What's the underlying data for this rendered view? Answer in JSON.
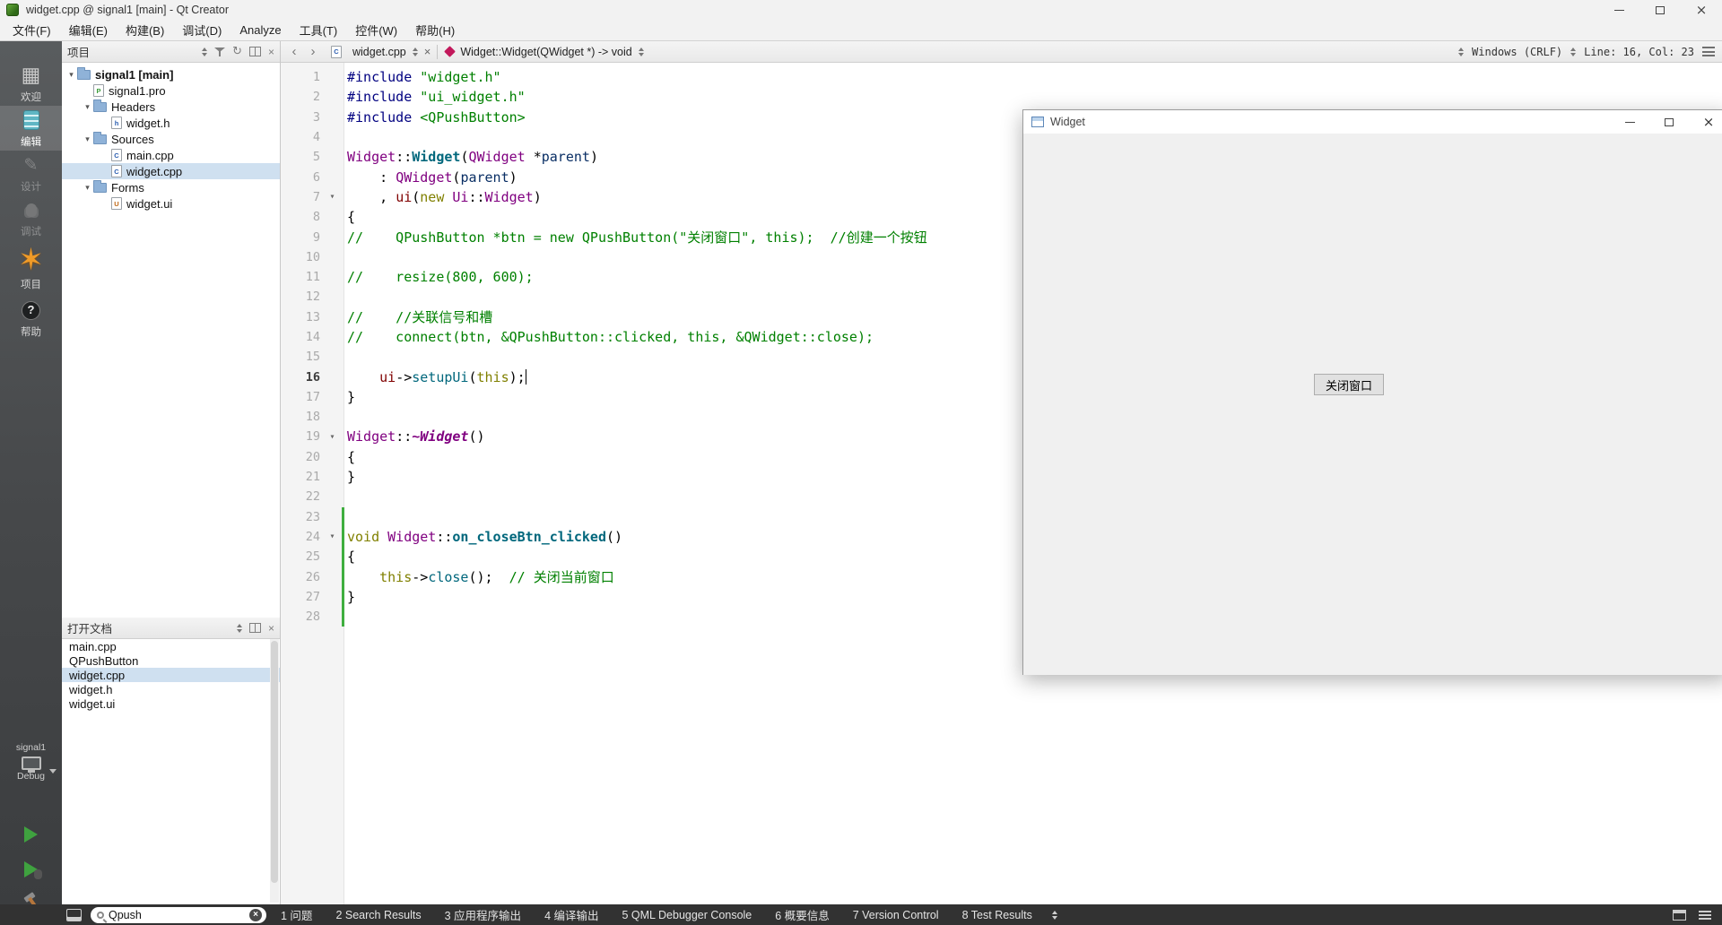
{
  "colors": {
    "syntax": {
      "pp": "#000080",
      "str": "#008000",
      "cmt": "#008000",
      "kw": "#808000",
      "typ": "#800080",
      "fn": "#00677c",
      "fld": "#800000",
      "loc": "#092e64",
      "pln": "#000000"
    },
    "ui": {
      "selection": "#cfe0f0",
      "vcs_added": "#3fae3f",
      "run_green": "#3fa23f",
      "status_bar_bg": "#323232"
    }
  },
  "window": {
    "title": "widget.cpp @ signal1 [main] - Qt Creator"
  },
  "menubar": {
    "items": [
      "文件(F)",
      "编辑(E)",
      "构建(B)",
      "调试(D)",
      "Analyze",
      "工具(T)",
      "控件(W)",
      "帮助(H)"
    ]
  },
  "mode_bar": {
    "items": [
      {
        "id": "welcome",
        "label": "欢迎",
        "selected": false,
        "disabled": false
      },
      {
        "id": "edit",
        "label": "编辑",
        "selected": true,
        "disabled": false
      },
      {
        "id": "design",
        "label": "设计",
        "selected": false,
        "disabled": true
      },
      {
        "id": "debug",
        "label": "调试",
        "selected": false,
        "disabled": true
      },
      {
        "id": "projects",
        "label": "项目",
        "selected": false,
        "disabled": false,
        "big": true
      },
      {
        "id": "help",
        "label": "帮助",
        "selected": false,
        "disabled": false
      }
    ],
    "target": {
      "project": "signal1",
      "config": "Debug"
    }
  },
  "projects_pane": {
    "title": "项目",
    "tree": [
      {
        "label": "signal1 [main]",
        "depth": 0,
        "type": "project",
        "expanded": true,
        "bold": true
      },
      {
        "label": "signal1.pro",
        "depth": 1,
        "type": "pro"
      },
      {
        "label": "Headers",
        "depth": 1,
        "type": "folder",
        "expanded": true
      },
      {
        "label": "widget.h",
        "depth": 2,
        "type": "h"
      },
      {
        "label": "Sources",
        "depth": 1,
        "type": "folder",
        "expanded": true
      },
      {
        "label": "main.cpp",
        "depth": 2,
        "type": "cpp"
      },
      {
        "label": "widget.cpp",
        "depth": 2,
        "type": "cpp",
        "selected": true
      },
      {
        "label": "Forms",
        "depth": 1,
        "type": "folder",
        "expanded": true
      },
      {
        "label": "widget.ui",
        "depth": 2,
        "type": "ui"
      }
    ]
  },
  "open_documents_pane": {
    "title": "打开文档",
    "items": [
      {
        "label": "main.cpp"
      },
      {
        "label": "QPushButton"
      },
      {
        "label": "widget.cpp",
        "selected": true
      },
      {
        "label": "widget.h"
      },
      {
        "label": "widget.ui"
      }
    ]
  },
  "editor": {
    "file_tab": "widget.cpp",
    "symbol": "Widget::Widget(QWidget *) -> void",
    "line_ending": "Windows (CRLF)",
    "cursor_text": "Line: 16, Col: 23",
    "current_line": 16,
    "cursor_col": 23,
    "fold_lines": [
      7,
      19,
      24
    ],
    "vcs_added": {
      "from": 23,
      "to": 28
    },
    "lines": [
      {
        "n": 1,
        "t": [
          [
            "pp",
            "#include "
          ],
          [
            "str",
            "\"widget.h\""
          ]
        ]
      },
      {
        "n": 2,
        "t": [
          [
            "pp",
            "#include "
          ],
          [
            "str",
            "\"ui_widget.h\""
          ]
        ]
      },
      {
        "n": 3,
        "t": [
          [
            "pp",
            "#include "
          ],
          [
            "str",
            "<QPushButton>"
          ]
        ]
      },
      {
        "n": 4,
        "t": []
      },
      {
        "n": 5,
        "t": [
          [
            "typ",
            "Widget"
          ],
          [
            "pln",
            "::"
          ],
          [
            "fnb",
            "Widget"
          ],
          [
            "pln",
            "("
          ],
          [
            "typ",
            "QWidget"
          ],
          [
            "pln",
            " *"
          ],
          [
            "loc",
            "parent"
          ],
          [
            "pln",
            ")"
          ]
        ]
      },
      {
        "n": 6,
        "t": [
          [
            "pln",
            "    : "
          ],
          [
            "typ",
            "QWidget"
          ],
          [
            "pln",
            "("
          ],
          [
            "loc",
            "parent"
          ],
          [
            "pln",
            ")"
          ]
        ]
      },
      {
        "n": 7,
        "t": [
          [
            "pln",
            "    , "
          ],
          [
            "fld",
            "ui"
          ],
          [
            "pln",
            "("
          ],
          [
            "kw",
            "new"
          ],
          [
            "pln",
            " "
          ],
          [
            "typ",
            "Ui"
          ],
          [
            "pln",
            "::"
          ],
          [
            "typ",
            "Widget"
          ],
          [
            "pln",
            ")"
          ]
        ]
      },
      {
        "n": 8,
        "t": [
          [
            "pln",
            "{"
          ]
        ]
      },
      {
        "n": 9,
        "t": [
          [
            "cmt",
            "//    QPushButton *btn = new QPushButton(\"关闭窗口\", this);  //创建一个按钮"
          ]
        ]
      },
      {
        "n": 10,
        "t": []
      },
      {
        "n": 11,
        "t": [
          [
            "cmt",
            "//    resize(800, 600);"
          ]
        ]
      },
      {
        "n": 12,
        "t": []
      },
      {
        "n": 13,
        "t": [
          [
            "cmt",
            "//    //关联信号和槽"
          ]
        ]
      },
      {
        "n": 14,
        "t": [
          [
            "cmt",
            "//    connect(btn, &QPushButton::clicked, this, &QWidget::close);"
          ]
        ]
      },
      {
        "n": 15,
        "t": []
      },
      {
        "n": 16,
        "t": [
          [
            "pln",
            "    "
          ],
          [
            "fld",
            "ui"
          ],
          [
            "pln",
            "->"
          ],
          [
            "fn",
            "setupUi"
          ],
          [
            "pln",
            "("
          ],
          [
            "kw",
            "this"
          ],
          [
            "pln",
            ");"
          ]
        ]
      },
      {
        "n": 17,
        "t": [
          [
            "pln",
            "}"
          ]
        ]
      },
      {
        "n": 18,
        "t": []
      },
      {
        "n": 19,
        "t": [
          [
            "typ",
            "Widget"
          ],
          [
            "pln",
            "::"
          ],
          [
            "vtl",
            "~Widget"
          ],
          [
            "pln",
            "()"
          ]
        ]
      },
      {
        "n": 20,
        "t": [
          [
            "pln",
            "{"
          ]
        ]
      },
      {
        "n": 21,
        "t": [
          [
            "pln",
            "}"
          ]
        ]
      },
      {
        "n": 22,
        "t": []
      },
      {
        "n": 23,
        "t": []
      },
      {
        "n": 24,
        "t": [
          [
            "kw",
            "void"
          ],
          [
            "pln",
            " "
          ],
          [
            "typ",
            "Widget"
          ],
          [
            "pln",
            "::"
          ],
          [
            "fnb",
            "on_closeBtn_clicked"
          ],
          [
            "pln",
            "()"
          ]
        ]
      },
      {
        "n": 25,
        "t": [
          [
            "pln",
            "{"
          ]
        ]
      },
      {
        "n": 26,
        "t": [
          [
            "pln",
            "    "
          ],
          [
            "kw",
            "this"
          ],
          [
            "pln",
            "->"
          ],
          [
            "fn",
            "close"
          ],
          [
            "pln",
            "();  "
          ],
          [
            "cmt",
            "// 关闭当前窗口"
          ]
        ]
      },
      {
        "n": 27,
        "t": [
          [
            "pln",
            "}"
          ]
        ]
      },
      {
        "n": 28,
        "t": []
      }
    ]
  },
  "run_window": {
    "title": "Widget",
    "button": "关闭窗口"
  },
  "status_bar": {
    "search": {
      "value": "Qpush"
    },
    "tabs": [
      "1 问题",
      "2 Search Results",
      "3 应用程序输出",
      "4 编译输出",
      "5 QML Debugger Console",
      "6 概要信息",
      "7 Version Control",
      "8 Test Results"
    ]
  }
}
